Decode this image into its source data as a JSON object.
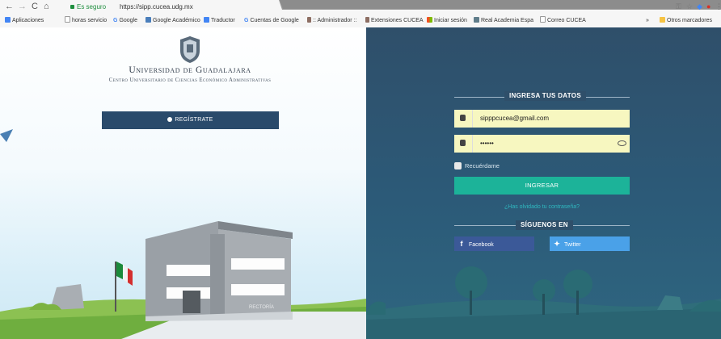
{
  "browser": {
    "nav": {
      "back": "←",
      "forward": "→",
      "reload": "C",
      "home": "⌂"
    },
    "secure_label": "Es seguro",
    "url": "https://sipp.cucea.udg.mx",
    "bookmarks": [
      {
        "label": "Aplicaciones",
        "color": "#4285f4"
      },
      {
        "label": "horas servicio",
        "color": "#9e9e9e"
      },
      {
        "label": "Google",
        "color": "#4285f4"
      },
      {
        "label": "Google Académico",
        "color": "#4a7ebb"
      },
      {
        "label": "Traductor",
        "color": "#4285f4"
      },
      {
        "label": "Cuentas de Google",
        "color": "#4285f4"
      },
      {
        "label": ":: Administrador ::",
        "color": "#8d6e63"
      },
      {
        "label": "Extensiones CUCEA",
        "color": "#8d6e63"
      },
      {
        "label": "Iniciar sesión",
        "color": "#e6a700"
      },
      {
        "label": "Real Academia Espa",
        "color": "#607d8b"
      },
      {
        "label": "Correo CUCEA",
        "color": "#9e9e9e"
      }
    ],
    "bookmarks_overflow": "»",
    "other_bookmarks": "Otros marcadores"
  },
  "brand": {
    "title": "Universidad de Guadalajara",
    "subtitle": "Centro Universitario de Ciencias Económico Administrativas",
    "building_sign": "RECTORÍA"
  },
  "register_label": "REGÍSTRATE",
  "login": {
    "heading": "INGRESA TUS DATOS",
    "email_value": "sipppcucea@gmail.com",
    "password_value": "••••••",
    "remember_label": "Recuérdame",
    "submit_label": "INGRESAR",
    "forgot_label": "¿Has olvidado tu contraseña?"
  },
  "social": {
    "heading": "SÍGUENOS EN",
    "facebook_label": "Facebook",
    "twitter_label": "Twitter"
  },
  "colors": {
    "register_button": "#2a4a6b",
    "login_button": "#1cb399",
    "facebook": "#3b5998",
    "twitter": "#4aa1e8",
    "input_bg": "#f7f7c0",
    "right_panel": "#2f4f6a"
  }
}
